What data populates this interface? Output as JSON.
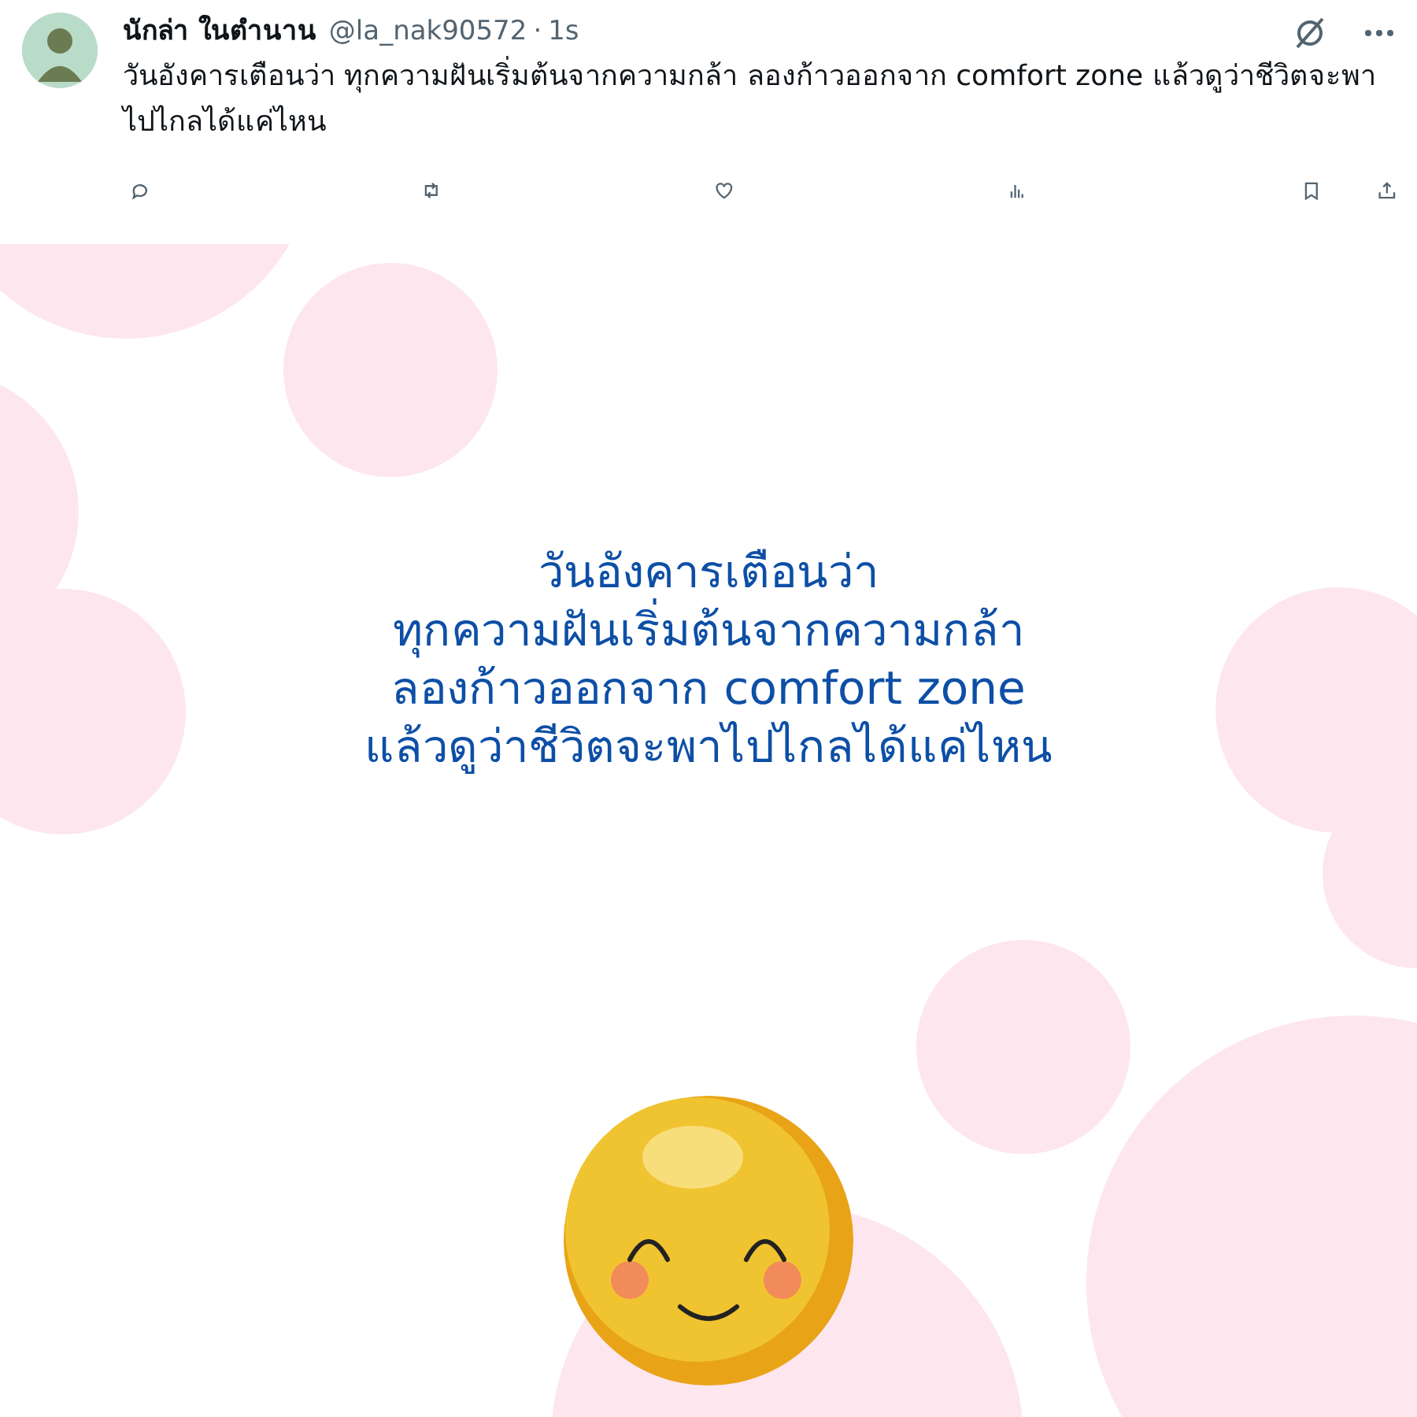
{
  "post": {
    "author": "นักล่า ในตำนาน",
    "handle": "@la_nak90572",
    "separator": "·",
    "time": "1s",
    "text": "วันอังคารเตือนว่า ทุกความฝันเริ่มต้นจากความกล้า ลองก้าวออกจาก comfort zone แล้วดูว่าชีวิตจะพาไปไกลได้แค่ไหน"
  },
  "image": {
    "lines": [
      "วันอังคารเตือนว่า",
      "ทุกความฝันเริ่มต้นจากความกล้า",
      "ลองก้าวออกจาก comfort zone",
      "แล้วดูว่าชีวิตจะพาไปไกลได้แค่ไหน"
    ]
  }
}
